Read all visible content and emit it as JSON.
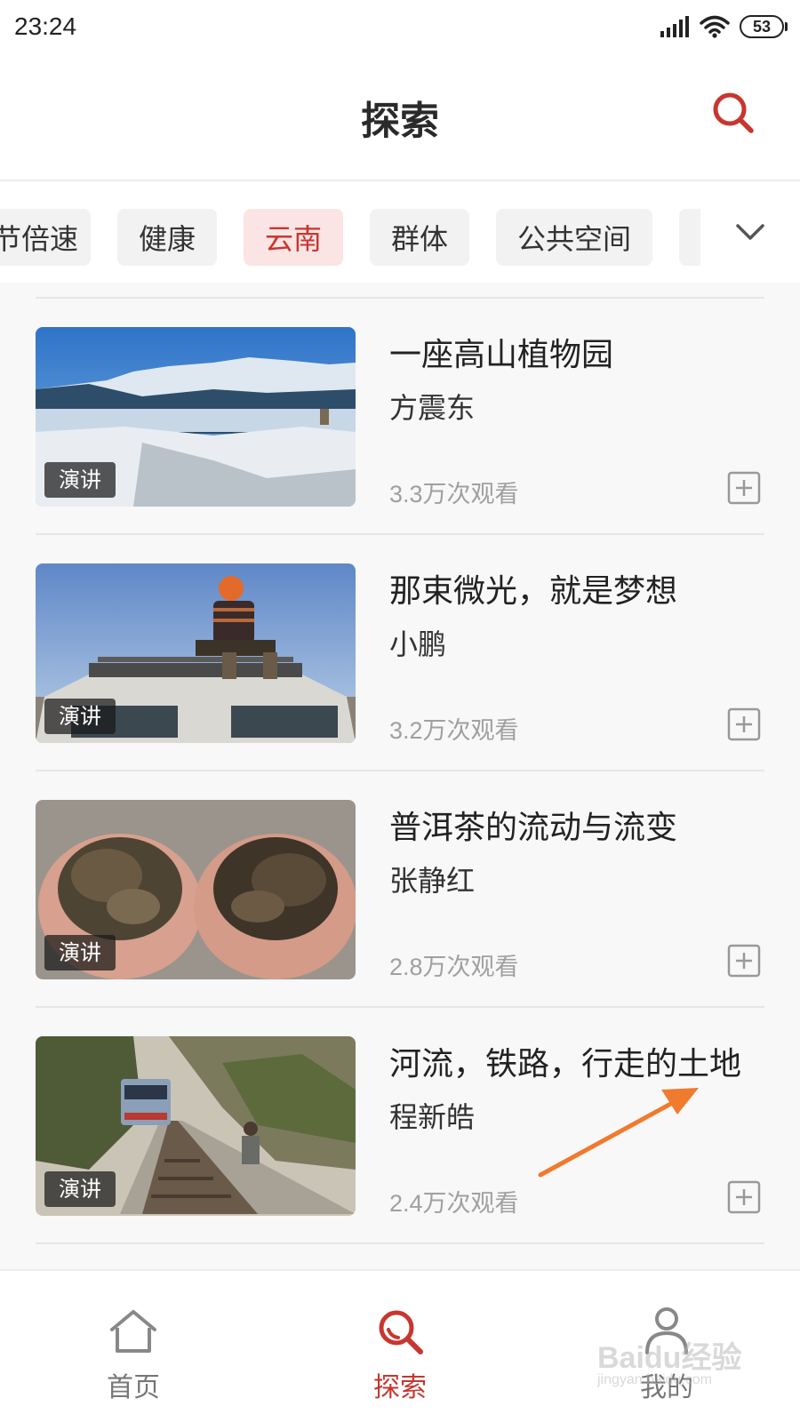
{
  "status_bar": {
    "time": "23:24",
    "battery": "53",
    "signal_icon": "signal-icon",
    "wifi_icon": "wifi-icon"
  },
  "header": {
    "title": "探索",
    "search_icon": "search-icon"
  },
  "categories": [
    {
      "label": "节倍速",
      "active": false
    },
    {
      "label": "健康",
      "active": false
    },
    {
      "label": "云南",
      "active": true
    },
    {
      "label": "群体",
      "active": false
    },
    {
      "label": "公共空间",
      "active": false
    },
    {
      "label": "",
      "active": false
    }
  ],
  "expand_icon": "chevron-down-icon",
  "talks": [
    {
      "title": "一座高山植物园",
      "speaker": "方震东",
      "views": "3.3万次观看",
      "tag": "演讲"
    },
    {
      "title": "那束微光，就是梦想",
      "speaker": "小鹏",
      "views": "3.2万次观看",
      "tag": "演讲"
    },
    {
      "title": "普洱茶的流动与流变",
      "speaker": "张静红",
      "views": "2.8万次观看",
      "tag": "演讲"
    },
    {
      "title": "河流，铁路，行走的土地",
      "speaker": "程新皓",
      "views": "2.4万次观看",
      "tag": "演讲"
    }
  ],
  "nav": [
    {
      "label": "首页",
      "icon": "home-icon",
      "active": false
    },
    {
      "label": "探索",
      "icon": "search-icon",
      "active": true
    },
    {
      "label": "我的",
      "icon": "profile-icon",
      "active": false
    }
  ],
  "watermark": {
    "main": "Baidu经验",
    "sub": "jingyan.baidu.com"
  },
  "colors": {
    "accent": "#c8362f",
    "annotation_arrow": "#f07a2e"
  }
}
